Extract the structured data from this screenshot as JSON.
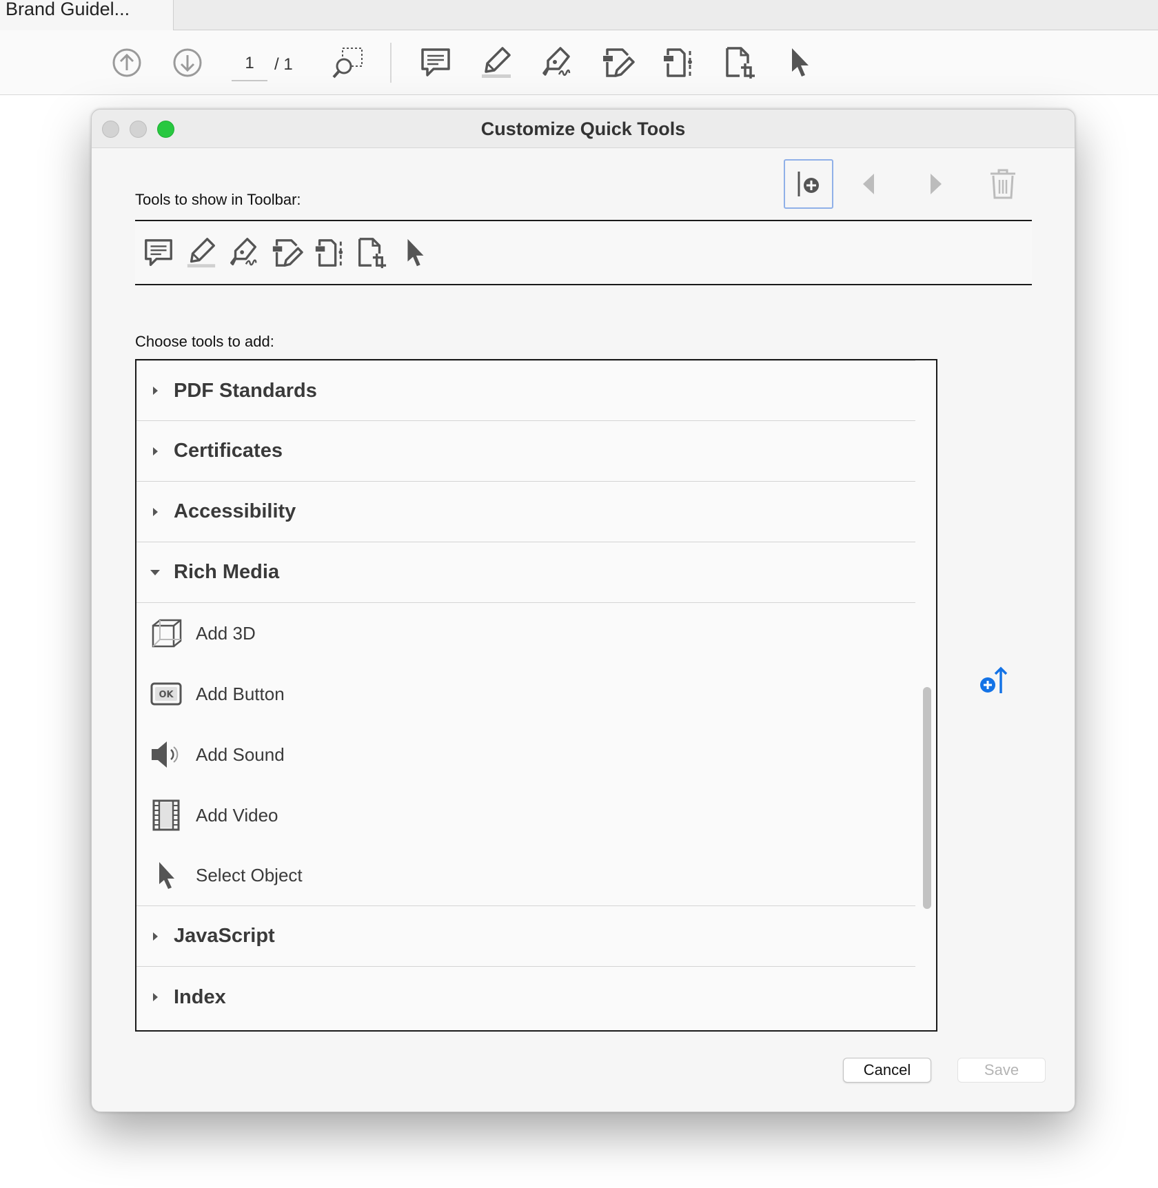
{
  "app": {
    "tab_title": "Brand Guidel..."
  },
  "toolbar": {
    "page_current": "1",
    "page_total": "/ 1",
    "icons": [
      "arrow-up-circle-icon",
      "arrow-down-circle-icon",
      "marquee-zoom-icon",
      "comment-icon",
      "highlight-icon",
      "sign-icon",
      "edit-pdf-icon",
      "organize-pages-icon",
      "crop-pages-icon",
      "select-pointer-icon"
    ]
  },
  "dialog": {
    "title": "Customize Quick Tools",
    "toolbar_label": "Tools to show in Toolbar:",
    "choose_label": "Choose tools to add:",
    "toolbar_tools": [
      "comment-icon",
      "highlight-icon",
      "sign-icon",
      "edit-pdf-icon",
      "organize-pages-icon",
      "crop-pages-icon",
      "select-pointer-icon"
    ],
    "categories": [
      {
        "label": "PDF Standards",
        "expanded": false
      },
      {
        "label": "Certificates",
        "expanded": false
      },
      {
        "label": "Accessibility",
        "expanded": false
      },
      {
        "label": "Rich Media",
        "expanded": true
      },
      {
        "label": "JavaScript",
        "expanded": false
      },
      {
        "label": "Index",
        "expanded": false
      }
    ],
    "rich_media_tools": [
      {
        "label": "Add 3D",
        "icon": "cube-3d-icon"
      },
      {
        "label": "Add Button",
        "icon": "ok-button-icon"
      },
      {
        "label": "Add Sound",
        "icon": "speaker-icon"
      },
      {
        "label": "Add Video",
        "icon": "film-icon"
      },
      {
        "label": "Select Object",
        "icon": "select-pointer-icon"
      }
    ],
    "buttons": {
      "cancel": "Cancel",
      "save": "Save"
    },
    "accent_color": "#1473e6"
  }
}
